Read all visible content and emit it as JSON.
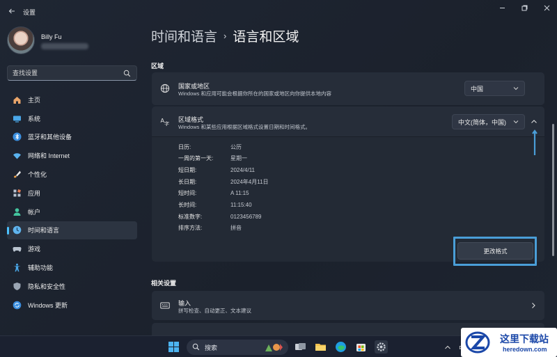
{
  "window": {
    "title": "设置"
  },
  "profile": {
    "name": "Billy Fu"
  },
  "search": {
    "placeholder": "查找设置"
  },
  "sidebar": {
    "items": [
      {
        "label": "主页",
        "icon": "home-icon"
      },
      {
        "label": "系统",
        "icon": "system-icon"
      },
      {
        "label": "蓝牙和其他设备",
        "icon": "bluetooth-icon"
      },
      {
        "label": "网络和 Internet",
        "icon": "wifi-icon"
      },
      {
        "label": "个性化",
        "icon": "brush-icon"
      },
      {
        "label": "应用",
        "icon": "apps-icon"
      },
      {
        "label": "帐户",
        "icon": "account-icon"
      },
      {
        "label": "时间和语言",
        "icon": "time-language-icon",
        "active": true
      },
      {
        "label": "游戏",
        "icon": "gamepad-icon"
      },
      {
        "label": "辅助功能",
        "icon": "accessibility-icon"
      },
      {
        "label": "隐私和安全性",
        "icon": "shield-icon"
      },
      {
        "label": "Windows 更新",
        "icon": "update-icon"
      }
    ]
  },
  "breadcrumb": {
    "parent": "时间和语言",
    "separator": "›",
    "current": "语言和区域"
  },
  "region": {
    "section_title": "区域",
    "country": {
      "title": "国家或地区",
      "subtitle": "Windows 和应用可能会根据你所在的国家或地区向你提供本地内容",
      "value": "中国"
    },
    "format": {
      "title": "区域格式",
      "subtitle": "Windows 和某些应用根据区域格式设置日期和时间格式。",
      "value": "中文(简体，中国)",
      "rows": [
        {
          "key": "日历:",
          "value": "公历"
        },
        {
          "key": "一周的第一天:",
          "value": "星期一"
        },
        {
          "key": "短日期:",
          "value": "2024/4/11"
        },
        {
          "key": "长日期:",
          "value": "2024年4月11日"
        },
        {
          "key": "短时间:",
          "value": "A 11:15"
        },
        {
          "key": "长时间:",
          "value": "11:15:40"
        },
        {
          "key": "标准数字:",
          "value": "0123456789"
        },
        {
          "key": "排序方法:",
          "value": "拼音"
        }
      ],
      "change_button": "更改格式"
    }
  },
  "related": {
    "section_title": "相关设置",
    "input": {
      "title": "输入",
      "subtitle": "拼写检查、自动更正、文本建议"
    }
  },
  "taskbar": {
    "search_label": "搜索",
    "ime": "中"
  },
  "watermark": {
    "title": "这里下载站",
    "url": "heredown.com"
  },
  "colors": {
    "accent": "#4cc2ff",
    "highlight": "#4a9ed8",
    "background": "#1f2633",
    "card": "#262d39"
  }
}
